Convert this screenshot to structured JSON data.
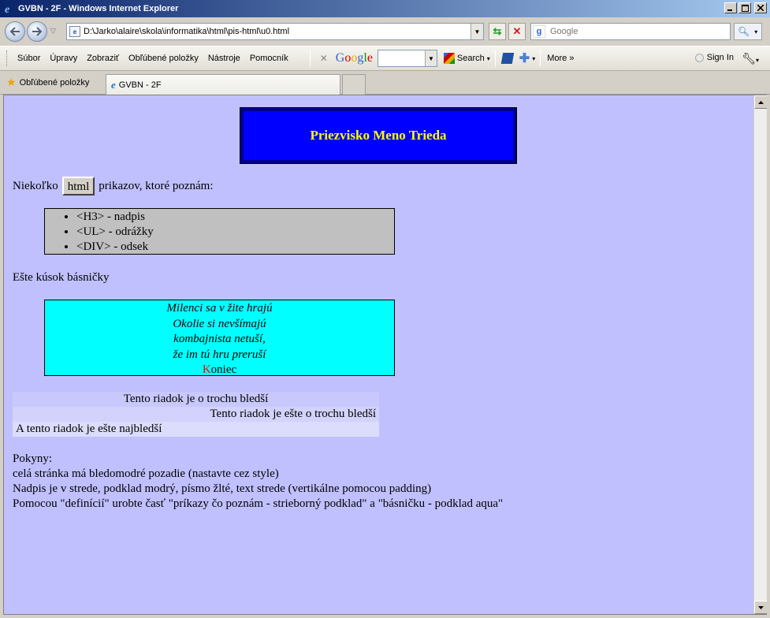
{
  "window": {
    "title": "GVBN - 2F - Windows Internet Explorer"
  },
  "address_bar": {
    "url": "D:\\Jarko\\alaire\\skola\\informatika\\html\\pis-html\\u0.html",
    "search_placeholder": "Google"
  },
  "menu": {
    "items": [
      "Súbor",
      "Úpravy",
      "Zobraziť",
      "Obľúbené položky",
      "Nástroje",
      "Pomocník"
    ]
  },
  "google_toolbar": {
    "logo": "Google",
    "search_label": "Search",
    "more_label": "More »",
    "sign_in_label": "Sign In"
  },
  "favorites_bar": {
    "label": "Obľúbené položky",
    "tab_title": "GVBN - 2F"
  },
  "page": {
    "heading": "Priezvisko Meno Trieda",
    "intro_before": "Niekoľko",
    "intro_button": "html",
    "intro_after": "prikazov, ktoré poznám:",
    "list_items": [
      "<H3> - nadpis",
      "<UL> - odrážky",
      "<DIV> - odsek"
    ],
    "poem_intro": "Ešte kúsok básničky",
    "poem_lines": [
      "Milenci sa v žite hrajú",
      "Okolie si nevšímajú",
      "kombajnista netuší,",
      "že im tú hru preruší"
    ],
    "poem_end_first": "K",
    "poem_end_rest": "oniec",
    "rows": [
      "Tento riadok je o trochu bledší",
      "Tento riadok je ešte o trochu bledší",
      "A tento riadok je ešte najbledší"
    ],
    "instructions": [
      "Pokyny:",
      "celá stránka má bledomodré pozadie (nastavte cez style)",
      "Nadpis je v strede, podklad modrý, písmo žlté, text strede (vertikálne pomocou padding)",
      "Pomocou \"definícií\" urobte časť \"príkazy čo poznám - strieborný podklad\" a \"básničku - podklad aqua\""
    ]
  },
  "colors": {
    "page_background": "#c0c0ff",
    "heading_background": "#0000ff",
    "heading_text": "#ffff00",
    "list_background": "#c0c0c0",
    "poem_background": "#00ffff"
  }
}
